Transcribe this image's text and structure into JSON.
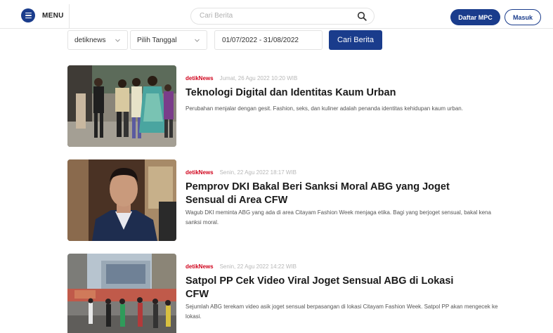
{
  "header": {
    "menu_label": "MENU",
    "search_placeholder": "Cari Berita",
    "daftar_label": "Daftar MPC",
    "masuk_label": "Masuk",
    "brand_color": "#1a3c8c"
  },
  "filters": {
    "source_value": "detiknews",
    "date_value": "Pilih Tanggal",
    "range_value": "01/07/2022 - 31/08/2022",
    "search_button": "Cari Berita"
  },
  "articles": [
    {
      "source": "detikNews",
      "date": "Jumat, 26 Agu 2022 10:20 WIB",
      "title": "Teknologi Digital dan Identitas Kaum Urban",
      "summary": "Perubahan menjalar dengan gesit. Fashion, seks, dan kuliner adalah penanda identitas kehidupan kaum urban."
    },
    {
      "source": "detikNews",
      "date": "Senin, 22 Agu 2022 18:17 WIB",
      "title": "Pemprov DKI Bakal Beri Sanksi Moral ABG yang Joget Sensual di Area CFW",
      "summary": "Wagub DKI meminta ABG yang ada di area Citayam Fashion Week menjaga etika. Bagi yang berjoget sensual, bakal kena sanksi moral."
    },
    {
      "source": "detikNews",
      "date": "Senin, 22 Agu 2022 14:22 WIB",
      "title": "Satpol PP Cek Video Viral Joget Sensual ABG di Lokasi CFW",
      "summary": "Sejumlah ABG terekam video asik joget sensual berpasangan di lokasi Citayam Fashion Week. Satpol PP akan mengecek ke lokasi."
    }
  ],
  "icons": {
    "menu": "hamburger-circle-icon",
    "search": "search-icon",
    "dropdown": "chevron-down-icon"
  }
}
